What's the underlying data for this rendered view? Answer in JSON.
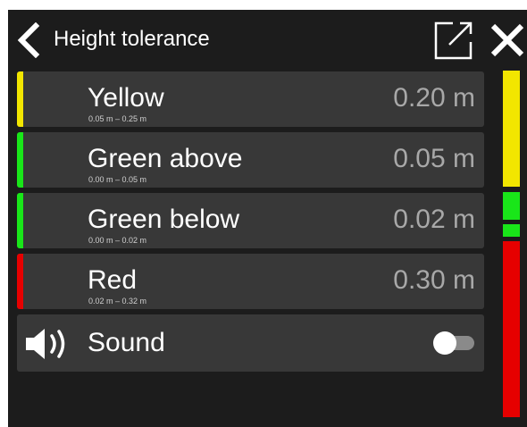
{
  "header": {
    "title": "Height tolerance",
    "back_icon": "chevron-left-icon",
    "popout_icon": "external-link-icon",
    "close_icon": "close-icon"
  },
  "tolerances": [
    {
      "label": "Yellow",
      "range": "0.05 m – 0.25 m",
      "value": "0.20 m",
      "color": "#f2e600"
    },
    {
      "label": "Green above",
      "range": "0.00 m – 0.05 m",
      "value": "0.05 m",
      "color": "#19e619"
    },
    {
      "label": "Green below",
      "range": "0.00 m – 0.02 m",
      "value": "0.02 m",
      "color": "#19e619"
    },
    {
      "label": "Red",
      "range": "0.02 m – 0.32 m",
      "value": "0.30 m",
      "color": "#e60000"
    }
  ],
  "sound": {
    "label": "Sound",
    "icon": "speaker-icon",
    "enabled": false
  },
  "gauge": {
    "yellow_color": "#f2e600",
    "green_color": "#19e619",
    "red_color": "#e60000"
  }
}
